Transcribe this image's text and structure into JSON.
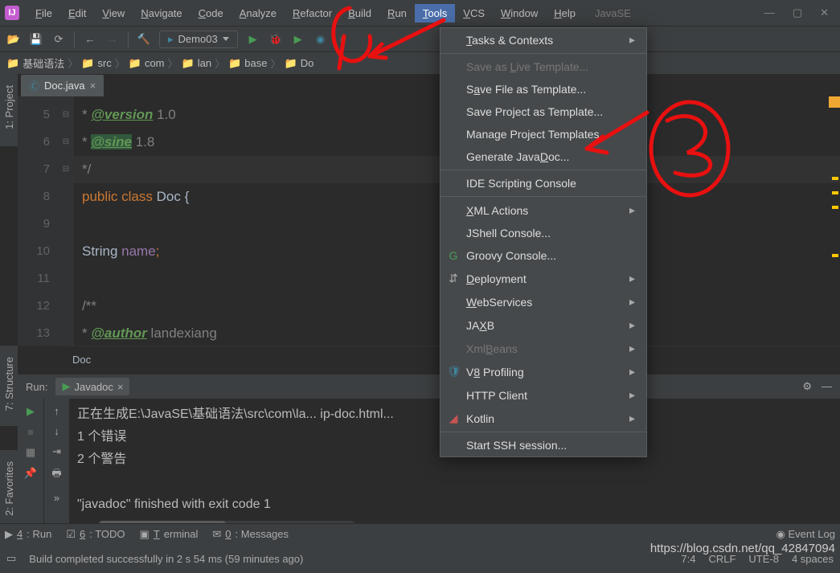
{
  "menubar": {
    "items": [
      "File",
      "Edit",
      "View",
      "Navigate",
      "Code",
      "Analyze",
      "Refactor",
      "Build",
      "Run",
      "Tools",
      "VCS",
      "Window",
      "Help"
    ],
    "active": "Tools",
    "title": "JavaSE"
  },
  "toolbar": {
    "run_config": "Demo03"
  },
  "breadcrumb": [
    "基础语法",
    "src",
    "com",
    "lan",
    "base",
    "Do"
  ],
  "tabs": [
    {
      "label": "Doc.java"
    }
  ],
  "sidebar_left": [
    "1: Project",
    "7: Structure",
    "2: Favorites"
  ],
  "editor": {
    "lines": [
      {
        "num": "5",
        "cmt": " * ",
        "anno": "@version",
        "rest": " 1.0",
        "hi": true
      },
      {
        "num": "6",
        "cmt": " * ",
        "anno": "@sine",
        "rest": " 1.8",
        "hi_bg": true
      },
      {
        "num": "7",
        "cmt": " */",
        "cur": true
      },
      {
        "num": "8",
        "kw": "public class ",
        "cls": "Doc ",
        "brace": "{"
      },
      {
        "num": "9"
      },
      {
        "num": "10",
        "indent": "    ",
        "cls": "String ",
        "str": "name",
        "semi": ";"
      },
      {
        "num": "11"
      },
      {
        "num": "12",
        "cmt": "    /**"
      },
      {
        "num": "13",
        "cmt": "     * ",
        "anno": "@author",
        "rest": "  landexiang"
      }
    ]
  },
  "breadcrumb_footer": "Doc",
  "run": {
    "label": "Run:",
    "tab": "Javadoc",
    "out1": "正在生成E:\\JavaSE\\基础语法\\src\\com\\la...                 ip-doc.html...",
    "out2a": "1",
    "out2b": " 个错误",
    "out3a": "2",
    "out3b": " 个警告",
    "out5": "\"javadoc\" finished with exit code 1"
  },
  "statusbar": {
    "items": [
      "4: Run",
      "6: TODO",
      "Terminal",
      "0: Messages"
    ],
    "event": "Event Log"
  },
  "statusbar2": {
    "build": "Build completed successfully in 2 s 54 ms (59 minutes ago)",
    "pos": "7:4",
    "crlf": "CRLF",
    "enc": "UTE-8",
    "sp": "4 spaces"
  },
  "tools_menu": [
    {
      "t": "top",
      "label": "Tasks & Contexts",
      "sub": true,
      "u": "T"
    },
    {
      "t": "sep"
    },
    {
      "label": "Save as Live Template...",
      "dis": true,
      "u": "L"
    },
    {
      "label": "Save File as Template...",
      "u": "a"
    },
    {
      "label": "Save Project as Template..."
    },
    {
      "label": "Manage Project Templates..."
    },
    {
      "label": "Generate JavaDoc...",
      "u": "D"
    },
    {
      "t": "sep"
    },
    {
      "label": "IDE Scripting Console"
    },
    {
      "t": "sep"
    },
    {
      "label": "XML Actions",
      "sub": true,
      "u": "X"
    },
    {
      "label": "JShell Console..."
    },
    {
      "label": "Groovy Console...",
      "ico": "G",
      "icocolor": "#499c54"
    },
    {
      "label": "Deployment",
      "sub": true,
      "ico": "⇵",
      "u": "D"
    },
    {
      "label": "WebServices",
      "sub": true,
      "u": "W"
    },
    {
      "label": "JAXB",
      "sub": true,
      "u": "X"
    },
    {
      "label": "XmlBeans",
      "sub": true,
      "dis": true,
      "u": "B"
    },
    {
      "label": "V8 Profiling",
      "sub": true,
      "ico": "🛡",
      "icocolor": "#3e86a0",
      "u": "8"
    },
    {
      "label": "HTTP Client",
      "sub": true
    },
    {
      "label": "Kotlin",
      "sub": true,
      "ico": "◢",
      "icocolor": "#c75450"
    },
    {
      "t": "sep"
    },
    {
      "label": "Start SSH session..."
    }
  ],
  "watermark": "https://blog.csdn.net/qq_42847094"
}
